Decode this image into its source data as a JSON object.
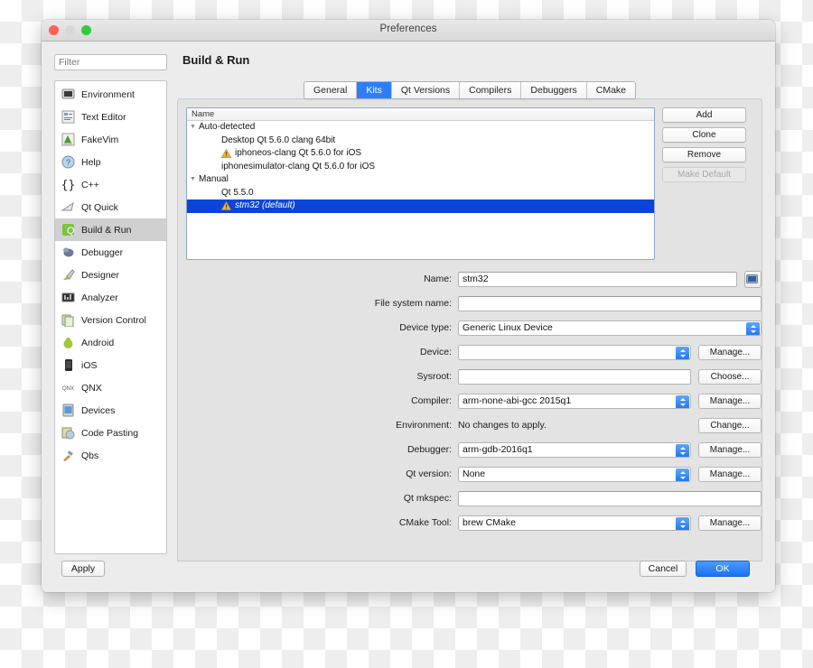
{
  "window": {
    "title": "Preferences",
    "traffic_lights": [
      "close-red",
      "minimize-disabled",
      "zoom-green"
    ]
  },
  "sidebar": {
    "filter_placeholder": "Filter",
    "items": [
      {
        "label": "Environment",
        "icon": "monitor-icon",
        "selected": false
      },
      {
        "label": "Text Editor",
        "icon": "text-editor-icon",
        "selected": false
      },
      {
        "label": "FakeVim",
        "icon": "fakevim-icon",
        "selected": false
      },
      {
        "label": "Help",
        "icon": "help-question-icon",
        "selected": false
      },
      {
        "label": "C++",
        "icon": "braces-icon",
        "selected": false
      },
      {
        "label": "Qt Quick",
        "icon": "qtquick-icon",
        "selected": false
      },
      {
        "label": "Build & Run",
        "icon": "build-run-icon",
        "selected": true
      },
      {
        "label": "Debugger",
        "icon": "debugger-bug-icon",
        "selected": false
      },
      {
        "label": "Designer",
        "icon": "designer-brush-icon",
        "selected": false
      },
      {
        "label": "Analyzer",
        "icon": "analyzer-icon",
        "selected": false
      },
      {
        "label": "Version Control",
        "icon": "version-control-icon",
        "selected": false
      },
      {
        "label": "Android",
        "icon": "android-icon",
        "selected": false
      },
      {
        "label": "iOS",
        "icon": "ios-phone-icon",
        "selected": false
      },
      {
        "label": "QNX",
        "icon": "qnx-icon",
        "selected": false
      },
      {
        "label": "Devices",
        "icon": "devices-icon",
        "selected": false
      },
      {
        "label": "Code Pasting",
        "icon": "code-pasting-icon",
        "selected": false
      },
      {
        "label": "Qbs",
        "icon": "qbs-hammer-icon",
        "selected": false
      }
    ]
  },
  "main": {
    "page_title": "Build & Run",
    "tabs": [
      {
        "label": "General",
        "active": false
      },
      {
        "label": "Kits",
        "active": true
      },
      {
        "label": "Qt Versions",
        "active": false
      },
      {
        "label": "Compilers",
        "active": false
      },
      {
        "label": "Debuggers",
        "active": false
      },
      {
        "label": "CMake",
        "active": false
      }
    ],
    "tree": {
      "header": "Name",
      "rows": [
        {
          "label": "Auto-detected",
          "level": 0,
          "twisty": "▼",
          "warn": false,
          "selected": false
        },
        {
          "label": "Desktop Qt 5.6.0 clang 64bit",
          "level": 2,
          "twisty": "",
          "warn": false,
          "selected": false
        },
        {
          "label": "iphoneos-clang Qt 5.6.0 for iOS",
          "level": 2,
          "twisty": "",
          "warn": true,
          "selected": false
        },
        {
          "label": "iphonesimulator-clang Qt 5.6.0 for iOS",
          "level": 2,
          "twisty": "",
          "warn": false,
          "selected": false
        },
        {
          "label": "Manual",
          "level": 0,
          "twisty": "▼",
          "warn": false,
          "selected": false
        },
        {
          "label": "Qt 5.5.0",
          "level": 2,
          "twisty": "",
          "warn": false,
          "selected": false
        },
        {
          "label": "stm32 (default)",
          "level": 2,
          "twisty": "",
          "warn": true,
          "selected": true
        }
      ]
    },
    "tree_buttons": [
      {
        "label": "Add",
        "disabled": false
      },
      {
        "label": "Clone",
        "disabled": false
      },
      {
        "label": "Remove",
        "disabled": false
      },
      {
        "label": "Make Default",
        "disabled": true
      }
    ],
    "form": {
      "name": {
        "label": "Name:",
        "value": "stm32",
        "type": "text",
        "button": "",
        "icon_button": "monitor-small-icon"
      },
      "fs_name": {
        "label": "File system name:",
        "value": "",
        "type": "text",
        "button": ""
      },
      "device_type": {
        "label": "Device type:",
        "value": "Generic Linux Device",
        "type": "combo",
        "button": ""
      },
      "device": {
        "label": "Device:",
        "value": "",
        "type": "combo",
        "button": "Manage..."
      },
      "sysroot": {
        "label": "Sysroot:",
        "value": "",
        "type": "text",
        "button": "Choose..."
      },
      "compiler": {
        "label": "Compiler:",
        "value": "arm-none-abi-gcc 2015q1",
        "type": "combo",
        "button": "Manage..."
      },
      "environment": {
        "label": "Environment:",
        "value": "No changes to apply.",
        "type": "static",
        "button": "Change..."
      },
      "debugger": {
        "label": "Debugger:",
        "value": "arm-gdb-2016q1",
        "type": "combo",
        "button": "Manage..."
      },
      "qt_version": {
        "label": "Qt version:",
        "value": "None",
        "type": "combo",
        "button": "Manage..."
      },
      "qt_mkspec": {
        "label": "Qt mkspec:",
        "value": "",
        "type": "text",
        "button": ""
      },
      "cmake_tool": {
        "label": "CMake Tool:",
        "value": "brew CMake",
        "type": "combo",
        "button": "Manage..."
      }
    }
  },
  "footer": {
    "apply": "Apply",
    "cancel": "Cancel",
    "ok": "OK"
  },
  "colors": {
    "accent_blue": "#2d7ff9",
    "selection_blue": "#0b44d8",
    "warning_yellow": "#f2b33d",
    "window_bg": "#ececec",
    "panel_bg": "#e3e3e3"
  }
}
